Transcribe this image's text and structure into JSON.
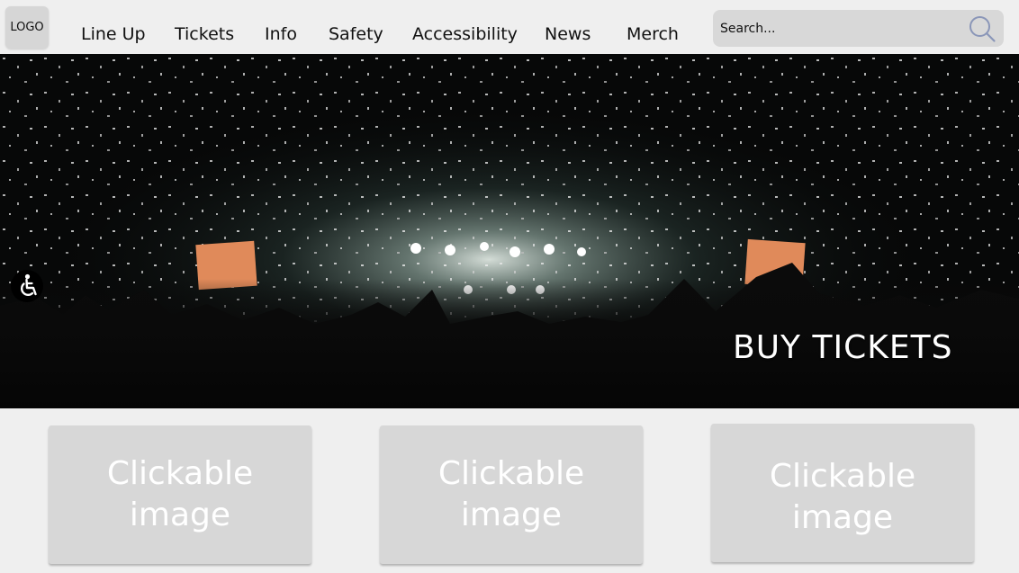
{
  "header": {
    "logo_label": "LOGO",
    "nav": [
      {
        "label": "Line Up"
      },
      {
        "label": "Tickets"
      },
      {
        "label": "Info"
      },
      {
        "label": "Safety"
      },
      {
        "label": "Accessibility"
      },
      {
        "label": "News"
      },
      {
        "label": "Merch"
      }
    ],
    "search": {
      "placeholder": "Search...",
      "icon": "search-icon"
    }
  },
  "hero": {
    "image": "concert-crowd-confetti-photo",
    "cta_label": "BUY TICKETS",
    "accessibility_icon": "wheelchair-icon"
  },
  "cards": [
    {
      "label": "Clickable\nimage"
    },
    {
      "label": "Clickable\nimage"
    },
    {
      "label": "Clickable\nimage"
    }
  ],
  "colors": {
    "page_background": "#efefef",
    "control_background": "#d7d7d7",
    "cta_text": "#ffffff"
  }
}
